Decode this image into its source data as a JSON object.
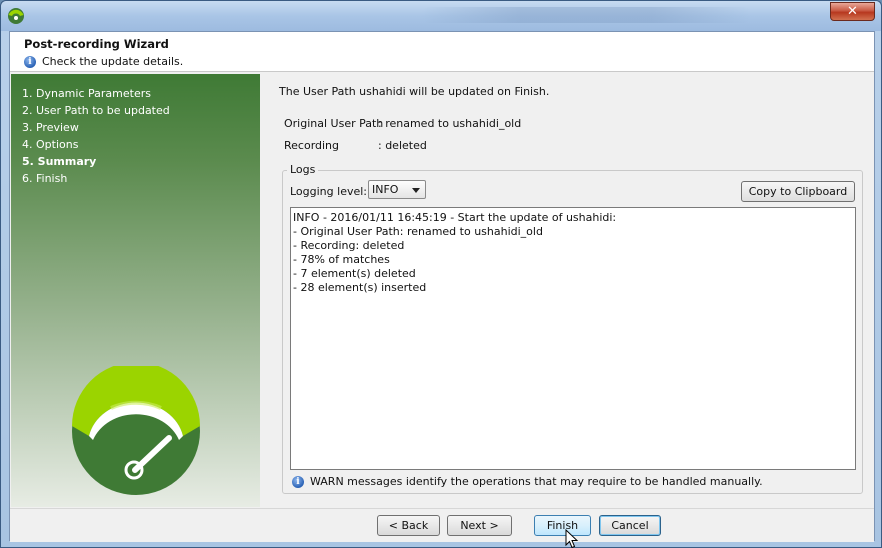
{
  "window": {
    "close_glyph": "✕"
  },
  "header": {
    "title": "Post-recording Wizard",
    "subtitle": "Check the update details.",
    "info_glyph": "i"
  },
  "sidebar": {
    "steps": [
      {
        "label": "1. Dynamic Parameters",
        "active": false
      },
      {
        "label": "2. User Path to be updated",
        "active": false
      },
      {
        "label": "3. Preview",
        "active": false
      },
      {
        "label": "4. Options",
        "active": false
      },
      {
        "label": "5. Summary",
        "active": true
      },
      {
        "label": "6. Finish",
        "active": false
      }
    ]
  },
  "main": {
    "intro": "The User Path ushahidi will be updated on Finish.",
    "details": [
      {
        "key": "Original User Path",
        "value": ": renamed to ushahidi_old"
      },
      {
        "key": "Recording",
        "value": ": deleted"
      }
    ],
    "logs": {
      "legend": "Logs",
      "level_label": "Logging level:",
      "level_value": "INFO",
      "copy_label": "Copy to Clipboard",
      "lines": [
        "INFO - 2016/01/11 16:45:19 - Start the update of ushahidi:",
        "- Original User Path: renamed to ushahidi_old",
        "- Recording: deleted",
        "- 78% of matches",
        "- 7 element(s) deleted",
        "- 28 element(s) inserted"
      ]
    },
    "warn_text": "WARN messages identify the operations that may require to be handled manually."
  },
  "footer": {
    "back_label": "< Back",
    "next_label": "Next >",
    "finish_label": "Finish",
    "cancel_label": "Cancel"
  },
  "colors": {
    "sidebar_top": "#3f7a35",
    "logo_lime": "#9bd400",
    "logo_green": "#3f7a35"
  }
}
